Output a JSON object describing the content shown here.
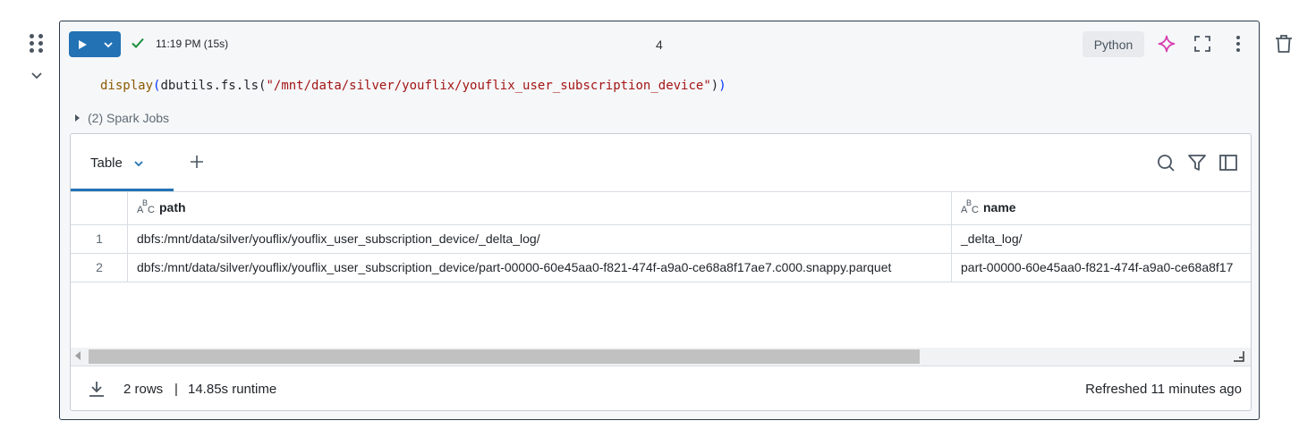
{
  "cell": {
    "exec_time": "11:19 PM (15s)",
    "cell_number": "4",
    "language": "Python",
    "code": {
      "fn": "display",
      "open": "(",
      "mid": "dbutils.fs.ls(",
      "str": "\"/mnt/data/silver/youflix/youflix_user_subscription_device\"",
      "close1": ")",
      "close2": ")"
    },
    "spark_jobs": "(2) Spark Jobs"
  },
  "output": {
    "tab_label": "Table",
    "columns": [
      "path",
      "name"
    ],
    "rows": [
      {
        "num": "1",
        "path": "dbfs:/mnt/data/silver/youflix/youflix_user_subscription_device/_delta_log/",
        "name": "_delta_log/"
      },
      {
        "num": "2",
        "path": "dbfs:/mnt/data/silver/youflix/youflix_user_subscription_device/part-00000-60e45aa0-f821-474f-a9a0-ce68a8f17ae7.c000.snappy.parquet",
        "name": "part-00000-60e45aa0-f821-474f-a9a0-ce68a8f17"
      }
    ],
    "footer": {
      "rows": "2 rows",
      "separator": "|",
      "runtime": "14.85s runtime",
      "refreshed": "Refreshed 11 minutes ago"
    }
  },
  "colors": {
    "accent": "#2272b4",
    "success": "#1a8f3c"
  },
  "icons": [
    "drag-handle-icon",
    "chevron-down-icon",
    "play-icon",
    "check-icon",
    "sparkle-icon",
    "fullscreen-icon",
    "kebab-icon",
    "trash-icon",
    "plus-icon",
    "search-icon",
    "filter-icon",
    "sidebar-panel-icon",
    "download-icon",
    "resize-corner-icon"
  ]
}
